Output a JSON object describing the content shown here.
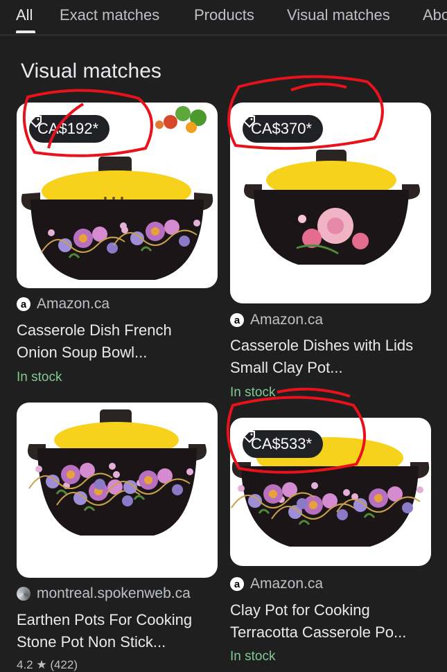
{
  "tabs": [
    "All",
    "Exact matches",
    "Products",
    "Visual matches",
    "About"
  ],
  "section_title": "Visual matches",
  "colors": {
    "background": "#1f1f1f",
    "in_stock": "#81c995",
    "annotation": "#e8121d",
    "lid_yellow": "#f7d21c"
  },
  "cards": [
    {
      "price": "CA$192*",
      "source": "Amazon.ca",
      "source_icon": "amazon-icon",
      "title": "Casserole Dish French Onion Soup Bowl...",
      "stock": "In stock"
    },
    {
      "price": "CA$370*",
      "source": "Amazon.ca",
      "source_icon": "amazon-icon",
      "title": "Casserole Dishes with Lids Small Clay Pot...",
      "stock": "In stock"
    },
    {
      "price": "",
      "source": "montreal.spokenweb.ca",
      "source_icon": "site-favicon-icon",
      "title": "Earthen Pots For Cooking Stone Pot Non Stick...",
      "rating": "4.2 ★ (422)"
    },
    {
      "price": "CA$533*",
      "source": "Amazon.ca",
      "source_icon": "amazon-icon",
      "title": "Clay Pot for Cooking Terracotta Casserole Po...",
      "stock": "In stock"
    }
  ]
}
